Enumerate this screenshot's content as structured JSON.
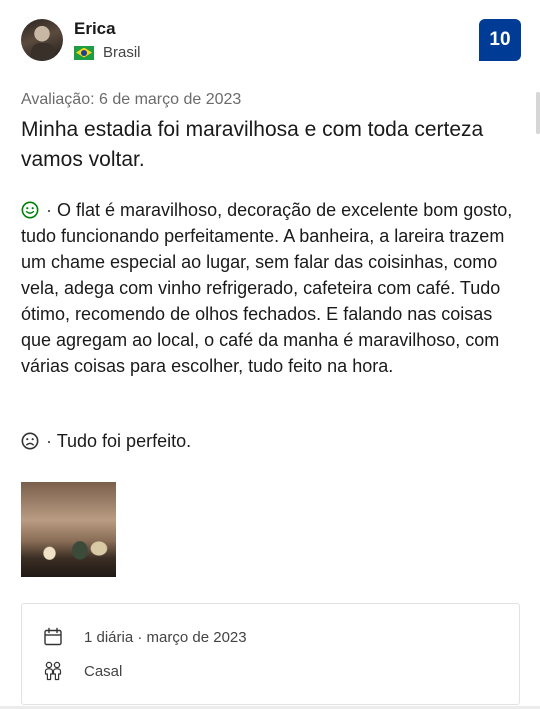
{
  "reviewer": {
    "name": "Erica",
    "country": "Brasil",
    "flag_icon": "brazil-flag-icon"
  },
  "score": "10",
  "colors": {
    "score_badge": "#003b95",
    "positive_icon": "#008009",
    "text": "#1a1a1a",
    "muted": "#6b6b6b"
  },
  "review": {
    "date": "Avaliação: 6 de março de 2023",
    "title": "Minha estadia foi maravilhosa e com toda certeza vamos voltar.",
    "positive_icon": "smile-icon",
    "positive": "O flat é maravilhoso, decoração de excelente bom gosto, tudo funcionando perfeitamente. A banheira, a lareira trazem um chame especial ao lugar, sem falar das coisinhas, como vela, adega com vinho refrigerado, cafeteira com café. Tudo ótimo, recomendo de olhos fechados. E falando nas coisas que agregam ao local, o café da manha é maravilhoso, com várias coisas para escolher, tudo feito na hora.",
    "negative_icon": "frown-icon",
    "negative": "Tudo foi perfeito.",
    "separator": "·"
  },
  "stay": {
    "duration": "1 diária · março de 2023",
    "duration_icon": "calendar-icon",
    "traveler_type": "Casal",
    "traveler_icon": "people-icon"
  }
}
